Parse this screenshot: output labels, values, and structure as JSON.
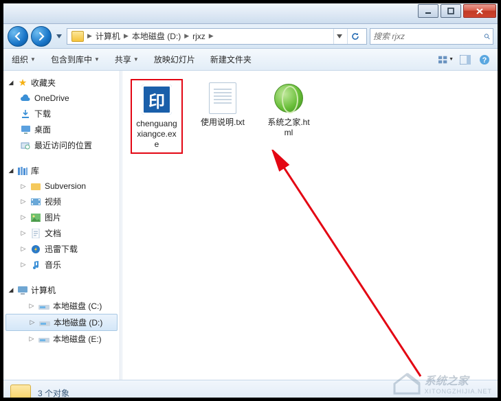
{
  "breadcrumb": {
    "seg1": "计算机",
    "seg2": "本地磁盘 (D:)",
    "seg3": "rjxz"
  },
  "search": {
    "placeholder": "搜索 rjxz"
  },
  "toolbar": {
    "organize": "组织",
    "include": "包含到库中",
    "share": "共享",
    "slideshow": "放映幻灯片",
    "newfolder": "新建文件夹"
  },
  "sidebar": {
    "favorites": {
      "label": "收藏夹",
      "items": [
        "OneDrive",
        "下载",
        "桌面",
        "最近访问的位置"
      ]
    },
    "libraries": {
      "label": "库",
      "items": [
        "Subversion",
        "视频",
        "图片",
        "文档",
        "迅雷下载",
        "音乐"
      ]
    },
    "computer": {
      "label": "计算机",
      "items": [
        "本地磁盘 (C:)",
        "本地磁盘 (D:)",
        "本地磁盘 (E:)"
      ]
    }
  },
  "files": [
    {
      "name": "chenguangxiangce.exe"
    },
    {
      "name": "使用说明.txt"
    },
    {
      "name": "系统之家.html"
    }
  ],
  "statusbar": {
    "count": "3 个对象"
  },
  "watermark": {
    "brand": "系统之家",
    "url": "XITONGZHIJIA.NET"
  }
}
